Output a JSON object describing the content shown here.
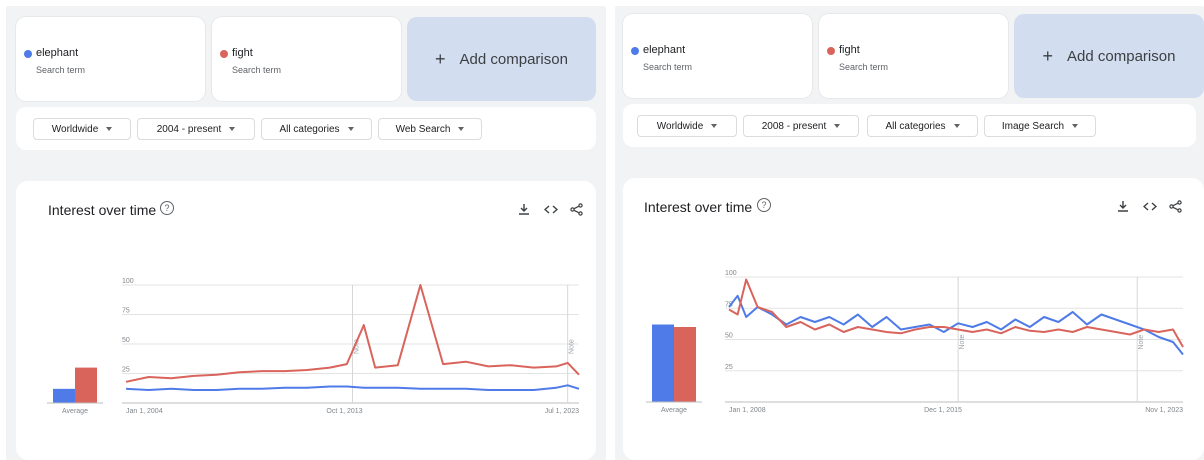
{
  "colors": {
    "series_blue": "#4f7be8",
    "series_red": "#d9645c",
    "add_bg": "#d3ddf0"
  },
  "left": {
    "terms": [
      {
        "name": "elephant",
        "sub": "Search term",
        "color": "#4f7be8"
      },
      {
        "name": "fight",
        "sub": "Search term",
        "color": "#d9645c"
      }
    ],
    "add_label": "Add comparison",
    "filters": [
      {
        "label": "Worldwide"
      },
      {
        "label": "2004 - present"
      },
      {
        "label": "All categories"
      },
      {
        "label": "Web Search"
      }
    ],
    "chart_title": "Interest over time",
    "icons": [
      "download-icon",
      "embed-icon",
      "share-icon"
    ],
    "average_label": "Average",
    "note_label": "Note",
    "chart_data": {
      "type": "line",
      "title": "Interest over time",
      "xlabel": "",
      "ylabel": "",
      "ylim": [
        0,
        100
      ],
      "yticks": [
        25,
        50,
        75,
        100
      ],
      "x_tick_labels": [
        "Jan 1, 2004",
        "Oct 1, 2013",
        "Jul 1, 2023"
      ],
      "x": [
        2004.0,
        2005.0,
        2006.0,
        2007.0,
        2008.0,
        2009.0,
        2010.0,
        2011.0,
        2012.0,
        2013.0,
        2013.75,
        2014.5,
        2015.0,
        2016.0,
        2017.0,
        2018.0,
        2019.0,
        2020.0,
        2021.0,
        2022.0,
        2023.0,
        2023.5,
        2024.0
      ],
      "series": [
        {
          "name": "elephant",
          "values": [
            12,
            11,
            12,
            11,
            11,
            12,
            12,
            13,
            13,
            14,
            14,
            13,
            13,
            13,
            12,
            12,
            12,
            11,
            11,
            11,
            13,
            15,
            12
          ]
        },
        {
          "name": "fight",
          "values": [
            18,
            22,
            21,
            23,
            24,
            26,
            27,
            27,
            28,
            30,
            33,
            66,
            30,
            32,
            100,
            33,
            35,
            31,
            32,
            30,
            31,
            34,
            24
          ]
        }
      ],
      "averages": [
        {
          "name": "elephant",
          "value": 12
        },
        {
          "name": "fight",
          "value": 30
        }
      ],
      "notes": [
        2014.0,
        2023.5
      ]
    }
  },
  "right": {
    "terms": [
      {
        "name": "elephant",
        "sub": "Search term",
        "color": "#4f7be8"
      },
      {
        "name": "fight",
        "sub": "Search term",
        "color": "#d9645c"
      }
    ],
    "add_label": "Add comparison",
    "filters": [
      {
        "label": "Worldwide"
      },
      {
        "label": "2008 - present"
      },
      {
        "label": "All categories"
      },
      {
        "label": "Image Search"
      }
    ],
    "chart_title": "Interest over time",
    "icons": [
      "download-icon",
      "embed-icon",
      "share-icon"
    ],
    "average_label": "Average",
    "note_label": "Note",
    "chart_data": {
      "type": "line",
      "title": "Interest over time",
      "xlabel": "",
      "ylabel": "",
      "ylim": [
        0,
        100
      ],
      "yticks": [
        25,
        50,
        75,
        100
      ],
      "x_tick_labels": [
        "Jan 1, 2008",
        "Dec 1, 2015",
        "Nov 1, 2023"
      ],
      "x": [
        2008.0,
        2008.3,
        2008.6,
        2009.0,
        2009.5,
        2010.0,
        2010.5,
        2011.0,
        2011.5,
        2012.0,
        2012.5,
        2013.0,
        2013.5,
        2014.0,
        2014.5,
        2015.0,
        2015.5,
        2016.0,
        2016.5,
        2017.0,
        2017.5,
        2018.0,
        2018.5,
        2019.0,
        2019.5,
        2020.0,
        2020.5,
        2021.0,
        2021.5,
        2022.0,
        2022.5,
        2023.0,
        2023.5,
        2023.85
      ],
      "series": [
        {
          "name": "elephant",
          "values": [
            76,
            85,
            68,
            76,
            70,
            62,
            68,
            64,
            68,
            62,
            70,
            60,
            68,
            58,
            60,
            62,
            56,
            63,
            60,
            64,
            58,
            66,
            60,
            68,
            64,
            72,
            62,
            70,
            66,
            62,
            58,
            52,
            48,
            38
          ]
        },
        {
          "name": "fight",
          "values": [
            74,
            70,
            98,
            76,
            72,
            60,
            64,
            58,
            62,
            56,
            60,
            58,
            56,
            55,
            58,
            60,
            60,
            58,
            56,
            58,
            55,
            60,
            57,
            56,
            58,
            56,
            60,
            58,
            56,
            54,
            58,
            56,
            58,
            44
          ]
        }
      ],
      "averages": [
        {
          "name": "elephant",
          "value": 62
        },
        {
          "name": "fight",
          "value": 60
        }
      ],
      "notes": [
        2016.0,
        2022.25
      ]
    }
  }
}
